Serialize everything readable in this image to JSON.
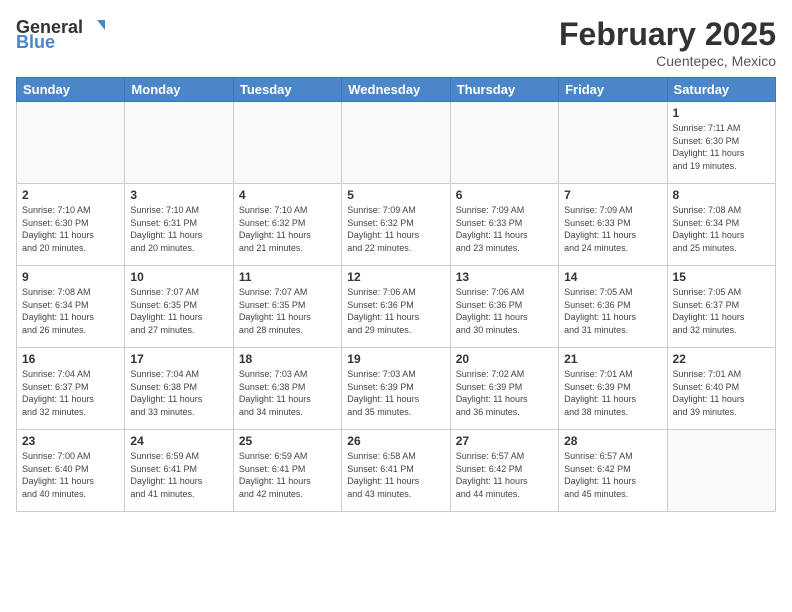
{
  "header": {
    "logo_general": "General",
    "logo_blue": "Blue",
    "month_year": "February 2025",
    "location": "Cuentepec, Mexico"
  },
  "weekdays": [
    "Sunday",
    "Monday",
    "Tuesday",
    "Wednesday",
    "Thursday",
    "Friday",
    "Saturday"
  ],
  "weeks": [
    [
      {
        "day": "",
        "info": ""
      },
      {
        "day": "",
        "info": ""
      },
      {
        "day": "",
        "info": ""
      },
      {
        "day": "",
        "info": ""
      },
      {
        "day": "",
        "info": ""
      },
      {
        "day": "",
        "info": ""
      },
      {
        "day": "1",
        "info": "Sunrise: 7:11 AM\nSunset: 6:30 PM\nDaylight: 11 hours\nand 19 minutes."
      }
    ],
    [
      {
        "day": "2",
        "info": "Sunrise: 7:10 AM\nSunset: 6:30 PM\nDaylight: 11 hours\nand 20 minutes."
      },
      {
        "day": "3",
        "info": "Sunrise: 7:10 AM\nSunset: 6:31 PM\nDaylight: 11 hours\nand 20 minutes."
      },
      {
        "day": "4",
        "info": "Sunrise: 7:10 AM\nSunset: 6:32 PM\nDaylight: 11 hours\nand 21 minutes."
      },
      {
        "day": "5",
        "info": "Sunrise: 7:09 AM\nSunset: 6:32 PM\nDaylight: 11 hours\nand 22 minutes."
      },
      {
        "day": "6",
        "info": "Sunrise: 7:09 AM\nSunset: 6:33 PM\nDaylight: 11 hours\nand 23 minutes."
      },
      {
        "day": "7",
        "info": "Sunrise: 7:09 AM\nSunset: 6:33 PM\nDaylight: 11 hours\nand 24 minutes."
      },
      {
        "day": "8",
        "info": "Sunrise: 7:08 AM\nSunset: 6:34 PM\nDaylight: 11 hours\nand 25 minutes."
      }
    ],
    [
      {
        "day": "9",
        "info": "Sunrise: 7:08 AM\nSunset: 6:34 PM\nDaylight: 11 hours\nand 26 minutes."
      },
      {
        "day": "10",
        "info": "Sunrise: 7:07 AM\nSunset: 6:35 PM\nDaylight: 11 hours\nand 27 minutes."
      },
      {
        "day": "11",
        "info": "Sunrise: 7:07 AM\nSunset: 6:35 PM\nDaylight: 11 hours\nand 28 minutes."
      },
      {
        "day": "12",
        "info": "Sunrise: 7:06 AM\nSunset: 6:36 PM\nDaylight: 11 hours\nand 29 minutes."
      },
      {
        "day": "13",
        "info": "Sunrise: 7:06 AM\nSunset: 6:36 PM\nDaylight: 11 hours\nand 30 minutes."
      },
      {
        "day": "14",
        "info": "Sunrise: 7:05 AM\nSunset: 6:36 PM\nDaylight: 11 hours\nand 31 minutes."
      },
      {
        "day": "15",
        "info": "Sunrise: 7:05 AM\nSunset: 6:37 PM\nDaylight: 11 hours\nand 32 minutes."
      }
    ],
    [
      {
        "day": "16",
        "info": "Sunrise: 7:04 AM\nSunset: 6:37 PM\nDaylight: 11 hours\nand 32 minutes."
      },
      {
        "day": "17",
        "info": "Sunrise: 7:04 AM\nSunset: 6:38 PM\nDaylight: 11 hours\nand 33 minutes."
      },
      {
        "day": "18",
        "info": "Sunrise: 7:03 AM\nSunset: 6:38 PM\nDaylight: 11 hours\nand 34 minutes."
      },
      {
        "day": "19",
        "info": "Sunrise: 7:03 AM\nSunset: 6:39 PM\nDaylight: 11 hours\nand 35 minutes."
      },
      {
        "day": "20",
        "info": "Sunrise: 7:02 AM\nSunset: 6:39 PM\nDaylight: 11 hours\nand 36 minutes."
      },
      {
        "day": "21",
        "info": "Sunrise: 7:01 AM\nSunset: 6:39 PM\nDaylight: 11 hours\nand 38 minutes."
      },
      {
        "day": "22",
        "info": "Sunrise: 7:01 AM\nSunset: 6:40 PM\nDaylight: 11 hours\nand 39 minutes."
      }
    ],
    [
      {
        "day": "23",
        "info": "Sunrise: 7:00 AM\nSunset: 6:40 PM\nDaylight: 11 hours\nand 40 minutes."
      },
      {
        "day": "24",
        "info": "Sunrise: 6:59 AM\nSunset: 6:41 PM\nDaylight: 11 hours\nand 41 minutes."
      },
      {
        "day": "25",
        "info": "Sunrise: 6:59 AM\nSunset: 6:41 PM\nDaylight: 11 hours\nand 42 minutes."
      },
      {
        "day": "26",
        "info": "Sunrise: 6:58 AM\nSunset: 6:41 PM\nDaylight: 11 hours\nand 43 minutes."
      },
      {
        "day": "27",
        "info": "Sunrise: 6:57 AM\nSunset: 6:42 PM\nDaylight: 11 hours\nand 44 minutes."
      },
      {
        "day": "28",
        "info": "Sunrise: 6:57 AM\nSunset: 6:42 PM\nDaylight: 11 hours\nand 45 minutes."
      },
      {
        "day": "",
        "info": ""
      }
    ]
  ]
}
